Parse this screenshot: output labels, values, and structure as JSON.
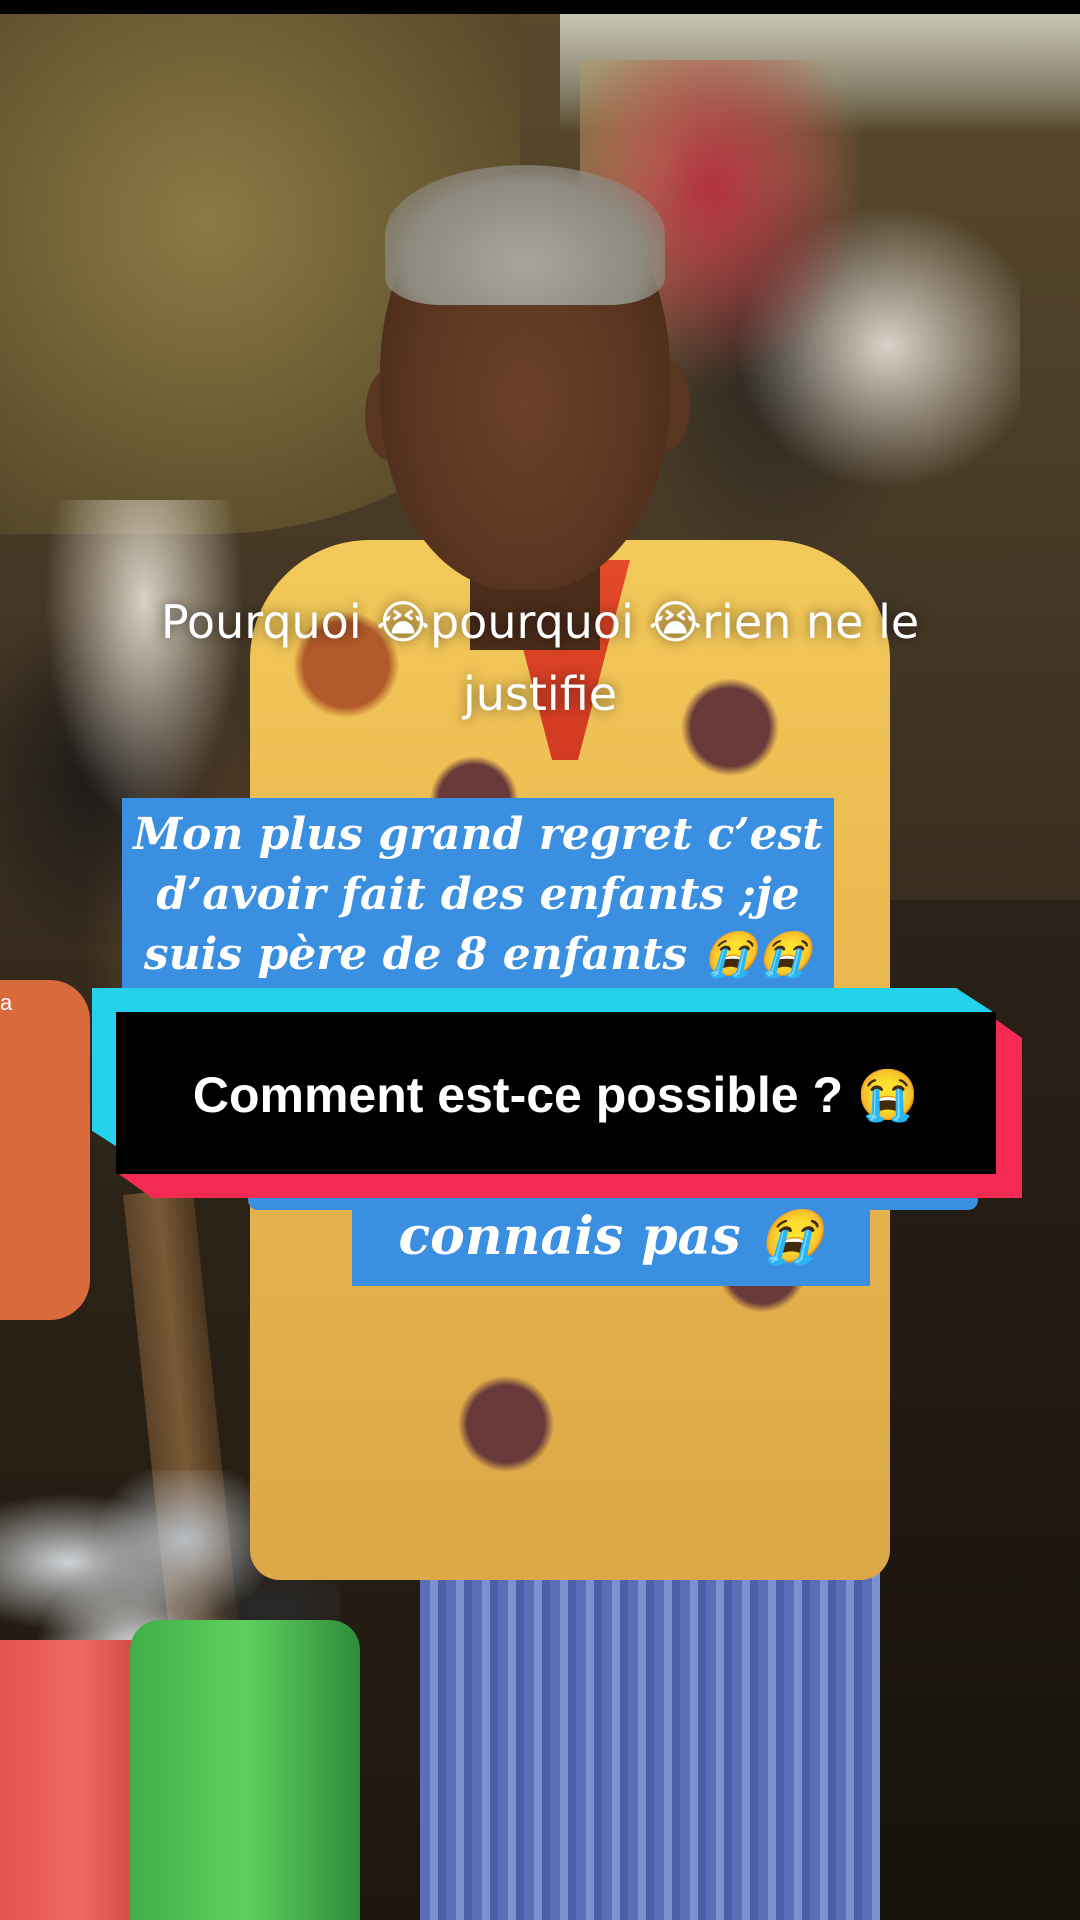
{
  "overlays": {
    "caption_top": "Pourquoi 😭pourquoi 😭rien ne le justifie",
    "blue_caption_1": "Mon plus grand regret c’est d’avoir fait des enfants ;je suis père de 8 enfants 😭😭",
    "dialog_question": "Comment est-ce possible ? 😭",
    "blue_caption_2": "connais pas 😭",
    "edge_letter": "a"
  },
  "colors": {
    "caption_blue": "#3a8fe0",
    "dialog_cyan": "#25d2ec",
    "dialog_red": "#f42a53",
    "dialog_black": "#000000"
  }
}
